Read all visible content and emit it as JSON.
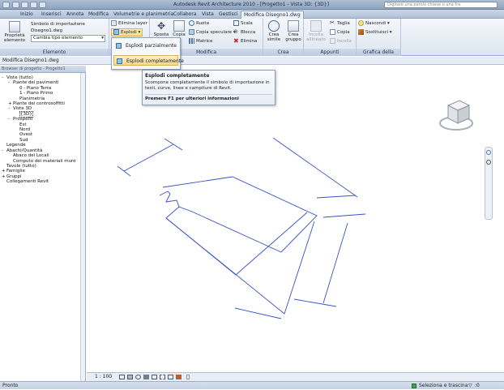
{
  "window": {
    "title": "Autodesk Revit Architecture 2010 - [Progetto1 - Vista 3D: {3D}]"
  },
  "search": {
    "placeholder": "Digitare una parola chiave o una fra"
  },
  "tabs": [
    "Inizio",
    "Inserisci",
    "Annota",
    "Modifica",
    "Volumetrie e planimetria",
    "Collabora",
    "Vista",
    "Gestisci",
    "Modifica Disegno1.dwg"
  ],
  "ribbon": {
    "elemento": {
      "label": "Elemento",
      "proprieta": "Proprietà elemento",
      "simbolo": "Simbolo di importazione",
      "file": "Disegno1.dwg",
      "cambia": "Cambia tipo elemento"
    },
    "import": {
      "elimina_layer": "Elimina layer",
      "esplodi": "Esplodi"
    },
    "modifica": {
      "label": "Modifica",
      "sposta": "Sposta",
      "copia": "Copia",
      "ruota": "Ruota",
      "copia_speculare": "Copia speculare",
      "matrice": "Matrice",
      "scala": "Scala",
      "blocca": "Blocca",
      "elimina": "Elimina"
    },
    "crea": {
      "label": "Crea",
      "crea_simile": "Crea simile",
      "crea_gruppo": "Crea gruppo"
    },
    "appunti": {
      "label": "Appunti",
      "incolla": "Incolla allineato",
      "taglia": "Taglia",
      "copia": "Copia",
      "incolla2": "Incolla"
    },
    "grafica": {
      "label": "Grafica della vista",
      "nascondi": "Nascondi",
      "sostituisci": "Sostituisci"
    }
  },
  "pathbar": {
    "text": "Modifica Disegno1.dwg"
  },
  "browser": {
    "header": "Browser di progetto - Progetto1",
    "tree": [
      {
        "label": "Viste (tutto)",
        "indent": 0,
        "toggle": "-"
      },
      {
        "label": "Piante dei pavimenti",
        "indent": 1,
        "toggle": "-"
      },
      {
        "label": "0 - Piano Terra",
        "indent": 2,
        "toggle": ""
      },
      {
        "label": "1 - Piano Primo",
        "indent": 2,
        "toggle": ""
      },
      {
        "label": "Planimetria",
        "indent": 2,
        "toggle": ""
      },
      {
        "label": "Piante dei controsoffitti",
        "indent": 1,
        "toggle": "+"
      },
      {
        "label": "Viste 3D",
        "indent": 1,
        "toggle": "-"
      },
      {
        "label": "{3D}",
        "indent": 2,
        "toggle": ""
      },
      {
        "label": "Prospetti",
        "indent": 1,
        "toggle": "-"
      },
      {
        "label": "Est",
        "indent": 2,
        "toggle": ""
      },
      {
        "label": "Nord",
        "indent": 2,
        "toggle": ""
      },
      {
        "label": "Ovest",
        "indent": 2,
        "toggle": ""
      },
      {
        "label": "Sud",
        "indent": 2,
        "toggle": ""
      },
      {
        "label": "Legende",
        "indent": 0,
        "toggle": ""
      },
      {
        "label": "Abachi/Quantità",
        "indent": 0,
        "toggle": "-"
      },
      {
        "label": "Abaco dei Locali",
        "indent": 1,
        "toggle": ""
      },
      {
        "label": "Computo dei materiali muro",
        "indent": 1,
        "toggle": ""
      },
      {
        "label": "Tavole (tutto)",
        "indent": 0,
        "toggle": ""
      },
      {
        "label": "Famiglie",
        "indent": 0,
        "toggle": "+"
      },
      {
        "label": "Gruppi",
        "indent": 0,
        "toggle": "+"
      },
      {
        "label": "Collegamenti Revit",
        "indent": 0,
        "toggle": ""
      }
    ]
  },
  "dropdown": {
    "items": [
      "Esplodi parzialmente",
      "Esplodi completamente"
    ],
    "selected_index": 1
  },
  "tooltip": {
    "title": "Esplodi completamente",
    "description": "Scompone completamente il simbolo di importazione in testi, curve, linee e campiture di Revit.",
    "help": "Premere F1 per ulteriori informazioni"
  },
  "viewcontrol": {
    "scale": "1 : 100"
  },
  "status": {
    "left": "Pronto",
    "select": "Seleziona e trascina",
    "filter": ":0"
  },
  "colors": {
    "accent": "#f8d88d",
    "ribbon": "#dde6f1",
    "linework": "#3a52c8"
  }
}
